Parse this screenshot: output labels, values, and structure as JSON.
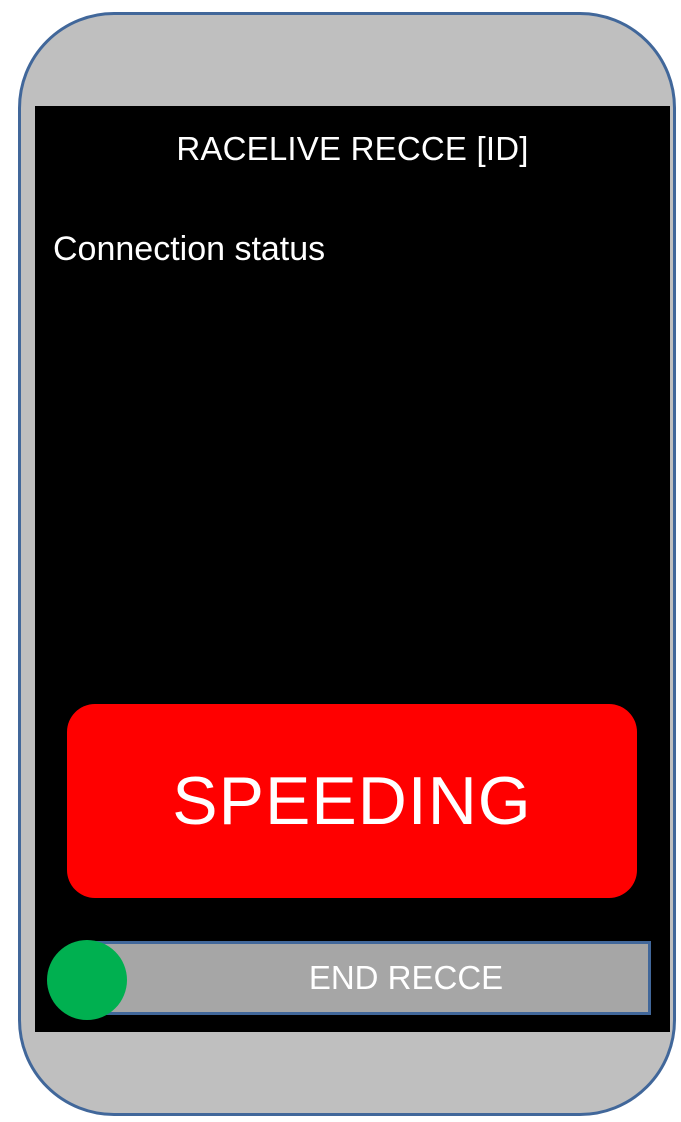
{
  "app": {
    "title": "RACELIVE RECCE [ID]",
    "connection_status_label": "Connection status"
  },
  "alert": {
    "label": "SPEEDING",
    "color": "#ff0000"
  },
  "end_control": {
    "label": "END RECCE",
    "track_color": "#a6a6a6",
    "handle_color": "#00b050"
  },
  "colors": {
    "frame": "#bfbfbf",
    "frame_border": "#41679a",
    "screen": "#000000"
  }
}
